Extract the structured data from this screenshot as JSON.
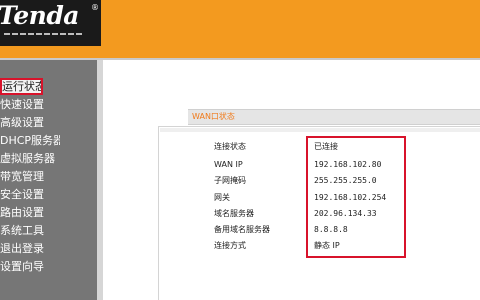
{
  "brand": {
    "logo_text": "Tenda",
    "registered_mark": "®"
  },
  "sidebar": {
    "items": [
      {
        "label": "运行状态",
        "active": true
      },
      {
        "label": "快速设置"
      },
      {
        "label": "高级设置"
      },
      {
        "label": "DHCP服务器"
      },
      {
        "label": "虚拟服务器"
      },
      {
        "label": "带宽管理"
      },
      {
        "label": "安全设置"
      },
      {
        "label": "路由设置"
      },
      {
        "label": "系统工具"
      },
      {
        "label": "退出登录"
      },
      {
        "label": "设置向导"
      }
    ]
  },
  "wan_status": {
    "title": "WAN口状态",
    "rows": [
      {
        "label": "连接状态",
        "value": "已连接"
      },
      {
        "label": "WAN IP",
        "value": "192.168.102.80"
      },
      {
        "label": "子网掩码",
        "value": "255.255.255.0"
      },
      {
        "label": "网关",
        "value": "192.168.102.254"
      },
      {
        "label": "域名服务器",
        "value": "202.96.134.33"
      },
      {
        "label": "备用域名服务器",
        "value": "8.8.8.8"
      },
      {
        "label": "连接方式",
        "value": "静态 IP"
      }
    ]
  },
  "colors": {
    "header": "#f39a1f",
    "sidebar": "#767676",
    "highlight": "#d8132b",
    "title_text": "#f07a1a"
  }
}
